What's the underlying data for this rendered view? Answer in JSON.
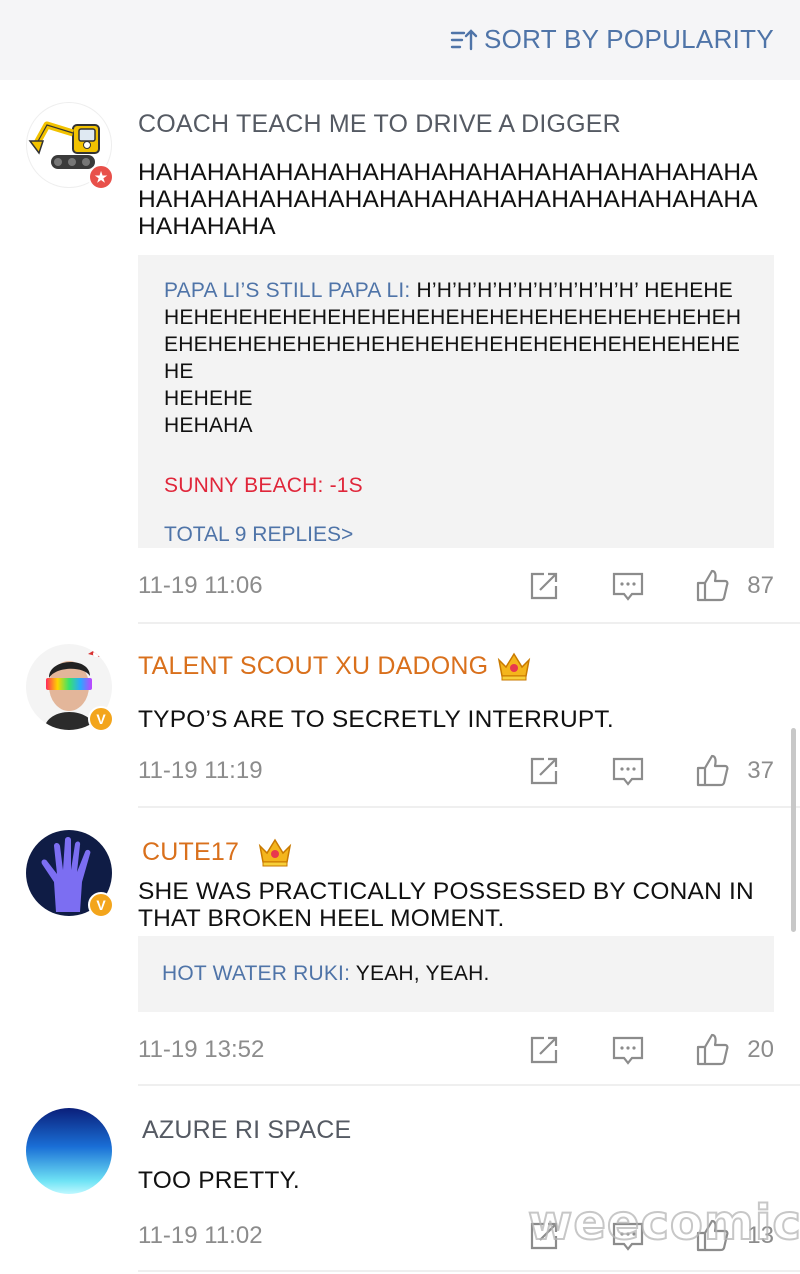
{
  "header": {
    "sort_label": "SORT BY POPULARITY",
    "sort_icon": "sort-icon"
  },
  "comments": [
    {
      "username": "COACH TEACH ME TO DRIVE A DIGGER",
      "avatar": "excavator-avatar",
      "badge": "★",
      "text": "HAHAHAHAHAHAHAHAHAHAHAHAHAHAHAHAHAHAHAHAHAHAHAHAHAHAHAHAHAHAHAHAHAHAHAHAHAHAHAHA",
      "replies": [
        {
          "name": "PAPA LI’S STILL PAPA LI:",
          "text": " H’H’H’H’H’H’H’H’H’H’H’ HEHEHEHEHEHEHEHEHEHEHEHEHEHEHEHEHEHEHEHEHEHEHEHEHEHEHEHEHEHEHEHEHEHEHEHEHEHEHEHEHEHEHE",
          "extra_lines": [
            "HEHEHE",
            "HEHAHA"
          ]
        },
        {
          "full": "SUNNY BEACH: -1S"
        }
      ],
      "total_replies": "TOTAL 9 REPLIES>",
      "time": "11-19 11:06",
      "likes": "87"
    },
    {
      "username": "TALENT SCOUT XU DADONG",
      "avatar": "man-with-rainbow-glasses-avatar",
      "badge": "V",
      "text": "TYPO’S ARE TO SECRETLY INTERRUPT.",
      "time": "11-19 11:19",
      "likes": "37"
    },
    {
      "username": "CUTE17",
      "avatar": "purple-hand-avatar",
      "badge": "V",
      "text": "SHE WAS PRACTICALLY POSSESSED BY CONAN IN THAT BROKEN HEEL MOMENT.",
      "replies": [
        {
          "name": "HOT WATER RUKI:",
          "text": " YEAH, YEAH."
        }
      ],
      "time": "11-19 13:52",
      "likes": "20"
    },
    {
      "username": "AZURE RI SPACE",
      "avatar": "blue-gradient-avatar",
      "text": "TOO PRETTY.",
      "time": "11-19 11:02",
      "likes": "13"
    }
  ],
  "watermark": "weecomics",
  "colors": {
    "link_blue": "#4f74a8",
    "vip_orange": "#d9701c",
    "reply_red": "#e0263a",
    "meta_gray": "#8c8c8c"
  }
}
